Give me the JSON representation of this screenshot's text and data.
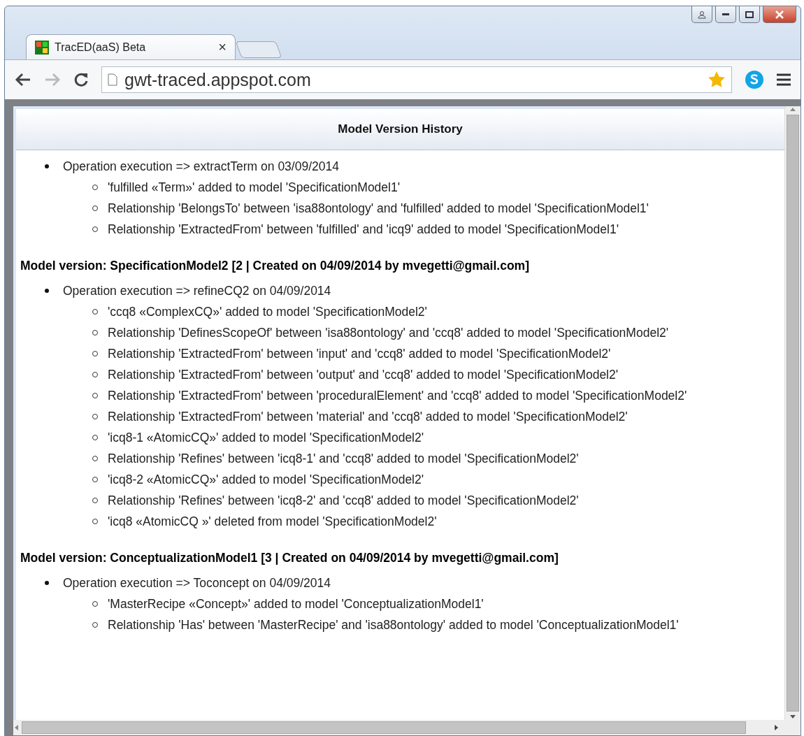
{
  "browser": {
    "tab_title": "TracED(aaS) Beta",
    "close_glyph": "×",
    "address": "gwt-traced.appspot.com"
  },
  "panel": {
    "title": "Model Version History",
    "sections": [
      {
        "operations": [
          {
            "text": "Operation execution => extractTerm on 03/09/2014",
            "changes": [
              "'fulfilled «Term»' added to model 'SpecificationModel1'",
              "Relationship 'BelongsTo' between 'isa88ontology' and 'fulfilled' added to model 'SpecificationModel1'",
              "Relationship 'ExtractedFrom' between 'fulfilled' and 'icq9' added to model 'SpecificationModel1'"
            ]
          }
        ]
      },
      {
        "heading": "Model version: SpecificationModel2 [2 | Created on 04/09/2014 by mvegetti@gmail.com]",
        "operations": [
          {
            "text": "Operation execution => refineCQ2 on 04/09/2014",
            "changes": [
              "'ccq8 «ComplexCQ»' added to model 'SpecificationModel2'",
              "Relationship 'DefinesScopeOf' between 'isa88ontology' and 'ccq8' added to model 'SpecificationModel2'",
              "Relationship 'ExtractedFrom' between 'input' and 'ccq8' added to model 'SpecificationModel2'",
              "Relationship 'ExtractedFrom' between 'output' and 'ccq8' added to model 'SpecificationModel2'",
              "Relationship 'ExtractedFrom' between 'proceduralElement' and 'ccq8' added to model 'SpecificationModel2'",
              "Relationship 'ExtractedFrom' between 'material' and 'ccq8' added to model 'SpecificationModel2'",
              "'icq8-1 «AtomicCQ»' added to model 'SpecificationModel2'",
              "Relationship 'Refines' between 'icq8-1' and 'ccq8' added to model 'SpecificationModel2'",
              "'icq8-2 «AtomicCQ»' added to model 'SpecificationModel2'",
              "Relationship 'Refines' between 'icq8-2' and 'ccq8' added to model 'SpecificationModel2'",
              "'icq8 «AtomicCQ »' deleted from model 'SpecificationModel2'"
            ]
          }
        ]
      },
      {
        "heading": "Model version: ConceptualizationModel1 [3 | Created on 04/09/2014 by mvegetti@gmail.com]",
        "operations": [
          {
            "text": "Operation execution => Toconcept on 04/09/2014",
            "changes": [
              "'MasterRecipe «Concept»' added to model 'ConceptualizationModel1'",
              "Relationship 'Has' between 'MasterRecipe' and 'isa88ontology' added to model 'ConceptualizationModel1'"
            ]
          }
        ]
      }
    ]
  }
}
